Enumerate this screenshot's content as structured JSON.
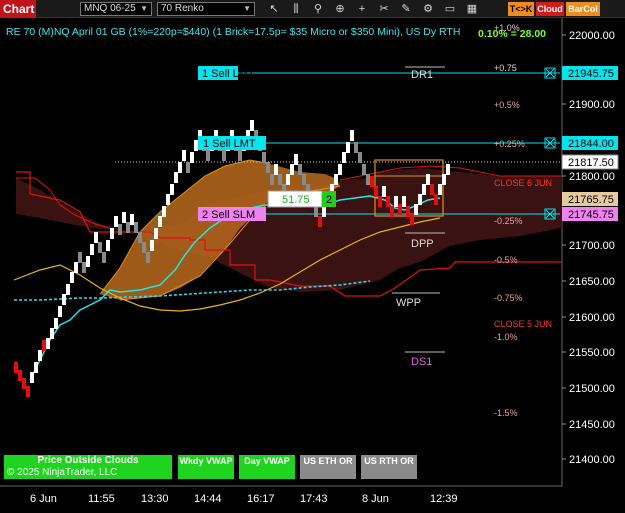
{
  "toolbar": {
    "title": "Chart",
    "instrument": "MNQ 06-25",
    "bar_type": "70 Renko",
    "icons": [
      "cursor-icon",
      "bar-style-icon",
      "zoom-icon",
      "crosshair-icon",
      "plus-icon",
      "cut-icon",
      "pencil-icon",
      "strategy-icon",
      "screen-icon",
      "layout-icon"
    ],
    "btn_tk": "T<>K",
    "btn_cloud": "Cloud",
    "btn_barcol": "BarCol"
  },
  "header": {
    "text": "RE 70 (M)NQ April 01 GB (1%=220p=$440) (1 Brick=17.5p= $35 Micro or $350 Mini), US Dy RTH",
    "pct": "0.10% = 28.00",
    "top_pct": "+1.0%"
  },
  "y_axis": {
    "ticks": [
      "22000.00",
      "21900.00",
      "21800.00",
      "21700.00",
      "21650.00",
      "21600.00",
      "21550.00",
      "21500.00",
      "21450.00",
      "21400.00"
    ]
  },
  "price_tags": {
    "t1": "21945.75",
    "t2": "21844.00",
    "t3": "21817.50",
    "t4": "21765.75",
    "t5": "21745.75"
  },
  "x_axis": {
    "ticks": [
      "6 Jun",
      "11:55",
      "13:30",
      "14:44",
      "16:17",
      "17:43",
      "8 Jun",
      "12:39"
    ]
  },
  "orders": {
    "sell_lmt_1": "1 Sell LMT",
    "sell_lmt_2": "1 Sell LMT",
    "sell_slm": "2 Sell SLM",
    "pnl": "51.75",
    "qty": "2"
  },
  "levels": {
    "dr1": "DR1",
    "dpp": "DPP",
    "wpp": "WPP",
    "ds1": "DS1",
    "p075": "+0.75",
    "p05": "+0.5%",
    "p025": "+0.25%",
    "close6": "CLOSE 6 JUN",
    "m025": "-0.25%",
    "m05": "-0.5%",
    "m075": "-0.75%",
    "close5": "CLOSE 5 JUN",
    "m10": "-1.0%",
    "m15": "-1.5%"
  },
  "boxes": {
    "clouds": "Price Outside Clouds",
    "copyright": "© 2025 NinjaTrader, LLC",
    "wkdy_vwap": "Wkdy VWAP",
    "day_vwap": "Day VWAP",
    "us_eth_or": "US ETH OR",
    "us_rth_or": "US RTH OR"
  },
  "colors": {
    "cyan": "#00e5ee",
    "magenta": "#ee82ee",
    "red": "#e01010",
    "orange": "#e0901a",
    "green": "#22dd22",
    "gray": "#8a8a8a"
  }
}
